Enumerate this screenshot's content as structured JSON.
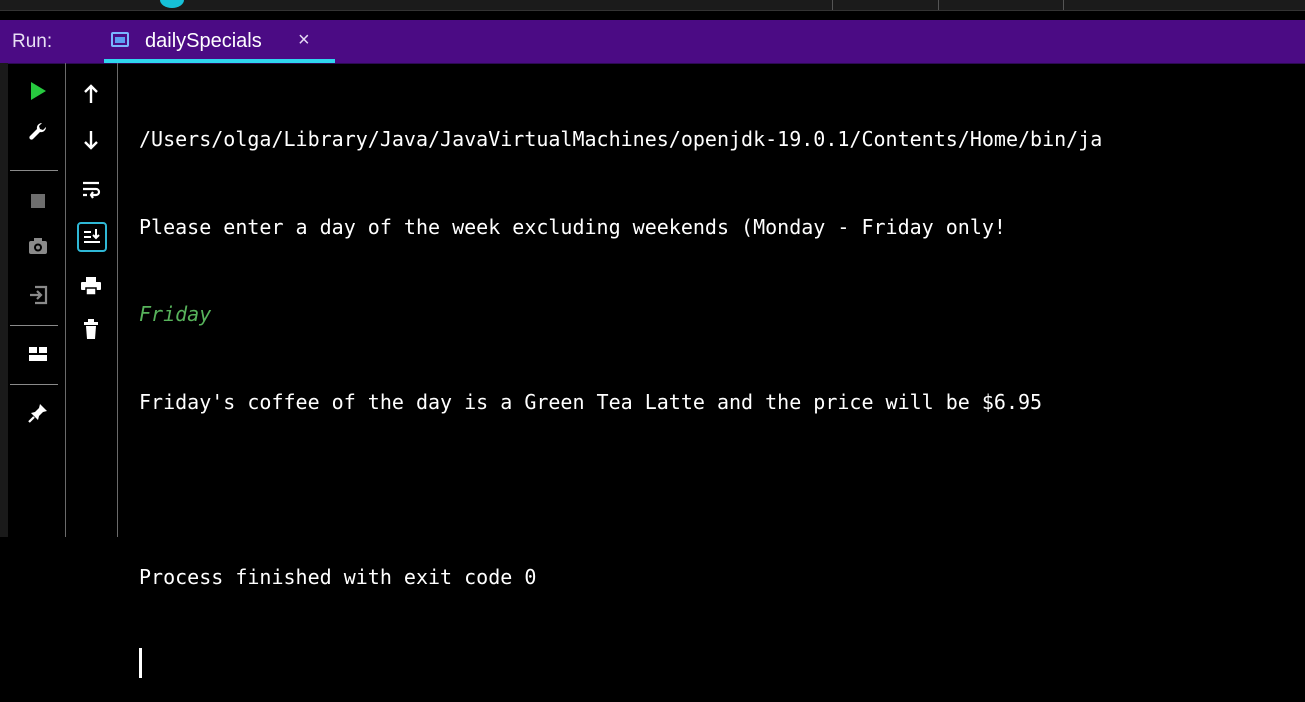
{
  "run_panel": {
    "label": "Run:",
    "tab": {
      "label": "dailySpecials",
      "close": "×"
    }
  },
  "toolbar_left": {
    "icons": [
      "run-icon",
      "wrench-icon",
      "stop-icon",
      "camera-icon",
      "login-icon",
      "layout-icon",
      "pin-icon"
    ]
  },
  "toolbar_right": {
    "icons": [
      "arrow-up-icon",
      "arrow-down-icon",
      "soft-wrap-icon",
      "scroll-to-end-icon",
      "print-icon",
      "trash-icon"
    ]
  },
  "console": {
    "lines": [
      "/Users/olga/Library/Java/JavaVirtualMachines/openjdk-19.0.1/Contents/Home/bin/ja",
      "Please enter a day of the week excluding weekends (Monday - Friday only!",
      "Friday",
      "Friday's coffee of the day is a Green Tea Latte and the price will be $6.95",
      "",
      "Process finished with exit code 0"
    ],
    "input_line_index": 2
  },
  "colors": {
    "tab_bar": "#4b0b84",
    "tab_underline": "#2fd6ef",
    "run_green": "#27c93f",
    "input_text": "#57b35b",
    "background": "#000000"
  }
}
